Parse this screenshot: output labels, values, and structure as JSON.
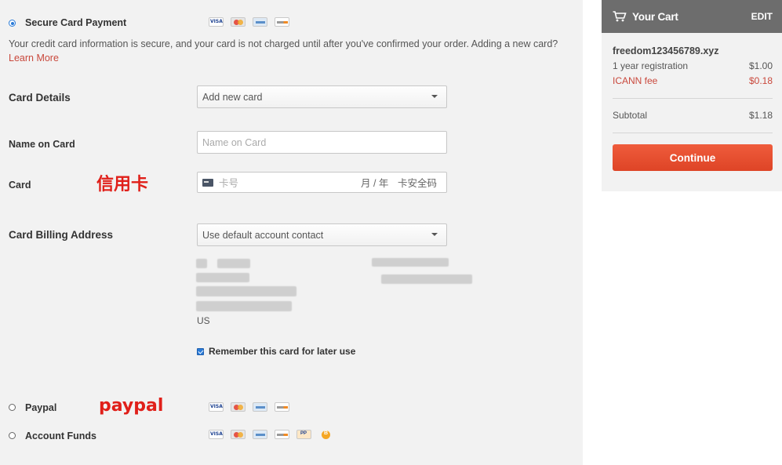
{
  "payment_methods": {
    "secure_card": {
      "label": "Secure Card Payment",
      "selected": true,
      "card_icons": [
        "visa-icon",
        "mastercard-icon",
        "amex-icon",
        "discover-icon"
      ]
    },
    "paypal": {
      "label": "Paypal",
      "selected": false,
      "card_icons": [
        "visa-icon",
        "mastercard-icon",
        "amex-icon",
        "discover-icon"
      ]
    },
    "account_funds": {
      "label": "Account Funds",
      "selected": false,
      "card_icons": [
        "visa-icon",
        "mastercard-icon",
        "amex-icon",
        "discover-icon",
        "paypal-icon",
        "bitcoin-icon"
      ]
    }
  },
  "info": {
    "text": "Your credit card information is secure, and your card is not charged until after you've confirmed your order. Adding a new card?",
    "learn_more": "Learn More"
  },
  "form": {
    "card_details": {
      "label": "Card Details",
      "value": "Add new card"
    },
    "name_on_card": {
      "label": "Name on Card",
      "placeholder": "Name on Card"
    },
    "card": {
      "label": "Card",
      "number_placeholder": "卡号",
      "expiry_placeholder": "月 / 年",
      "cvc_placeholder": "卡安全码"
    },
    "billing_address": {
      "label": "Card Billing Address",
      "value": "Use default account contact",
      "country": "US"
    },
    "remember": {
      "label": "Remember this card for later use",
      "checked": true
    }
  },
  "annotations": {
    "card": "信用卡",
    "paypal": "paypal"
  },
  "cart": {
    "title": "Your Cart",
    "edit": "EDIT",
    "domain": "freedom123456789.xyz",
    "items": [
      {
        "label": "1 year registration",
        "price": "$1.00"
      },
      {
        "label": "ICANN fee",
        "price": "$0.18"
      }
    ],
    "subtotal_label": "Subtotal",
    "subtotal_value": "$1.18",
    "continue": "Continue"
  },
  "colors": {
    "accent_blue": "#2a7bd8",
    "link_red": "#c9483c",
    "annotation_red": "#e0201a",
    "continue_orange": "#e44d2e",
    "cart_header": "#6d6d6d"
  }
}
